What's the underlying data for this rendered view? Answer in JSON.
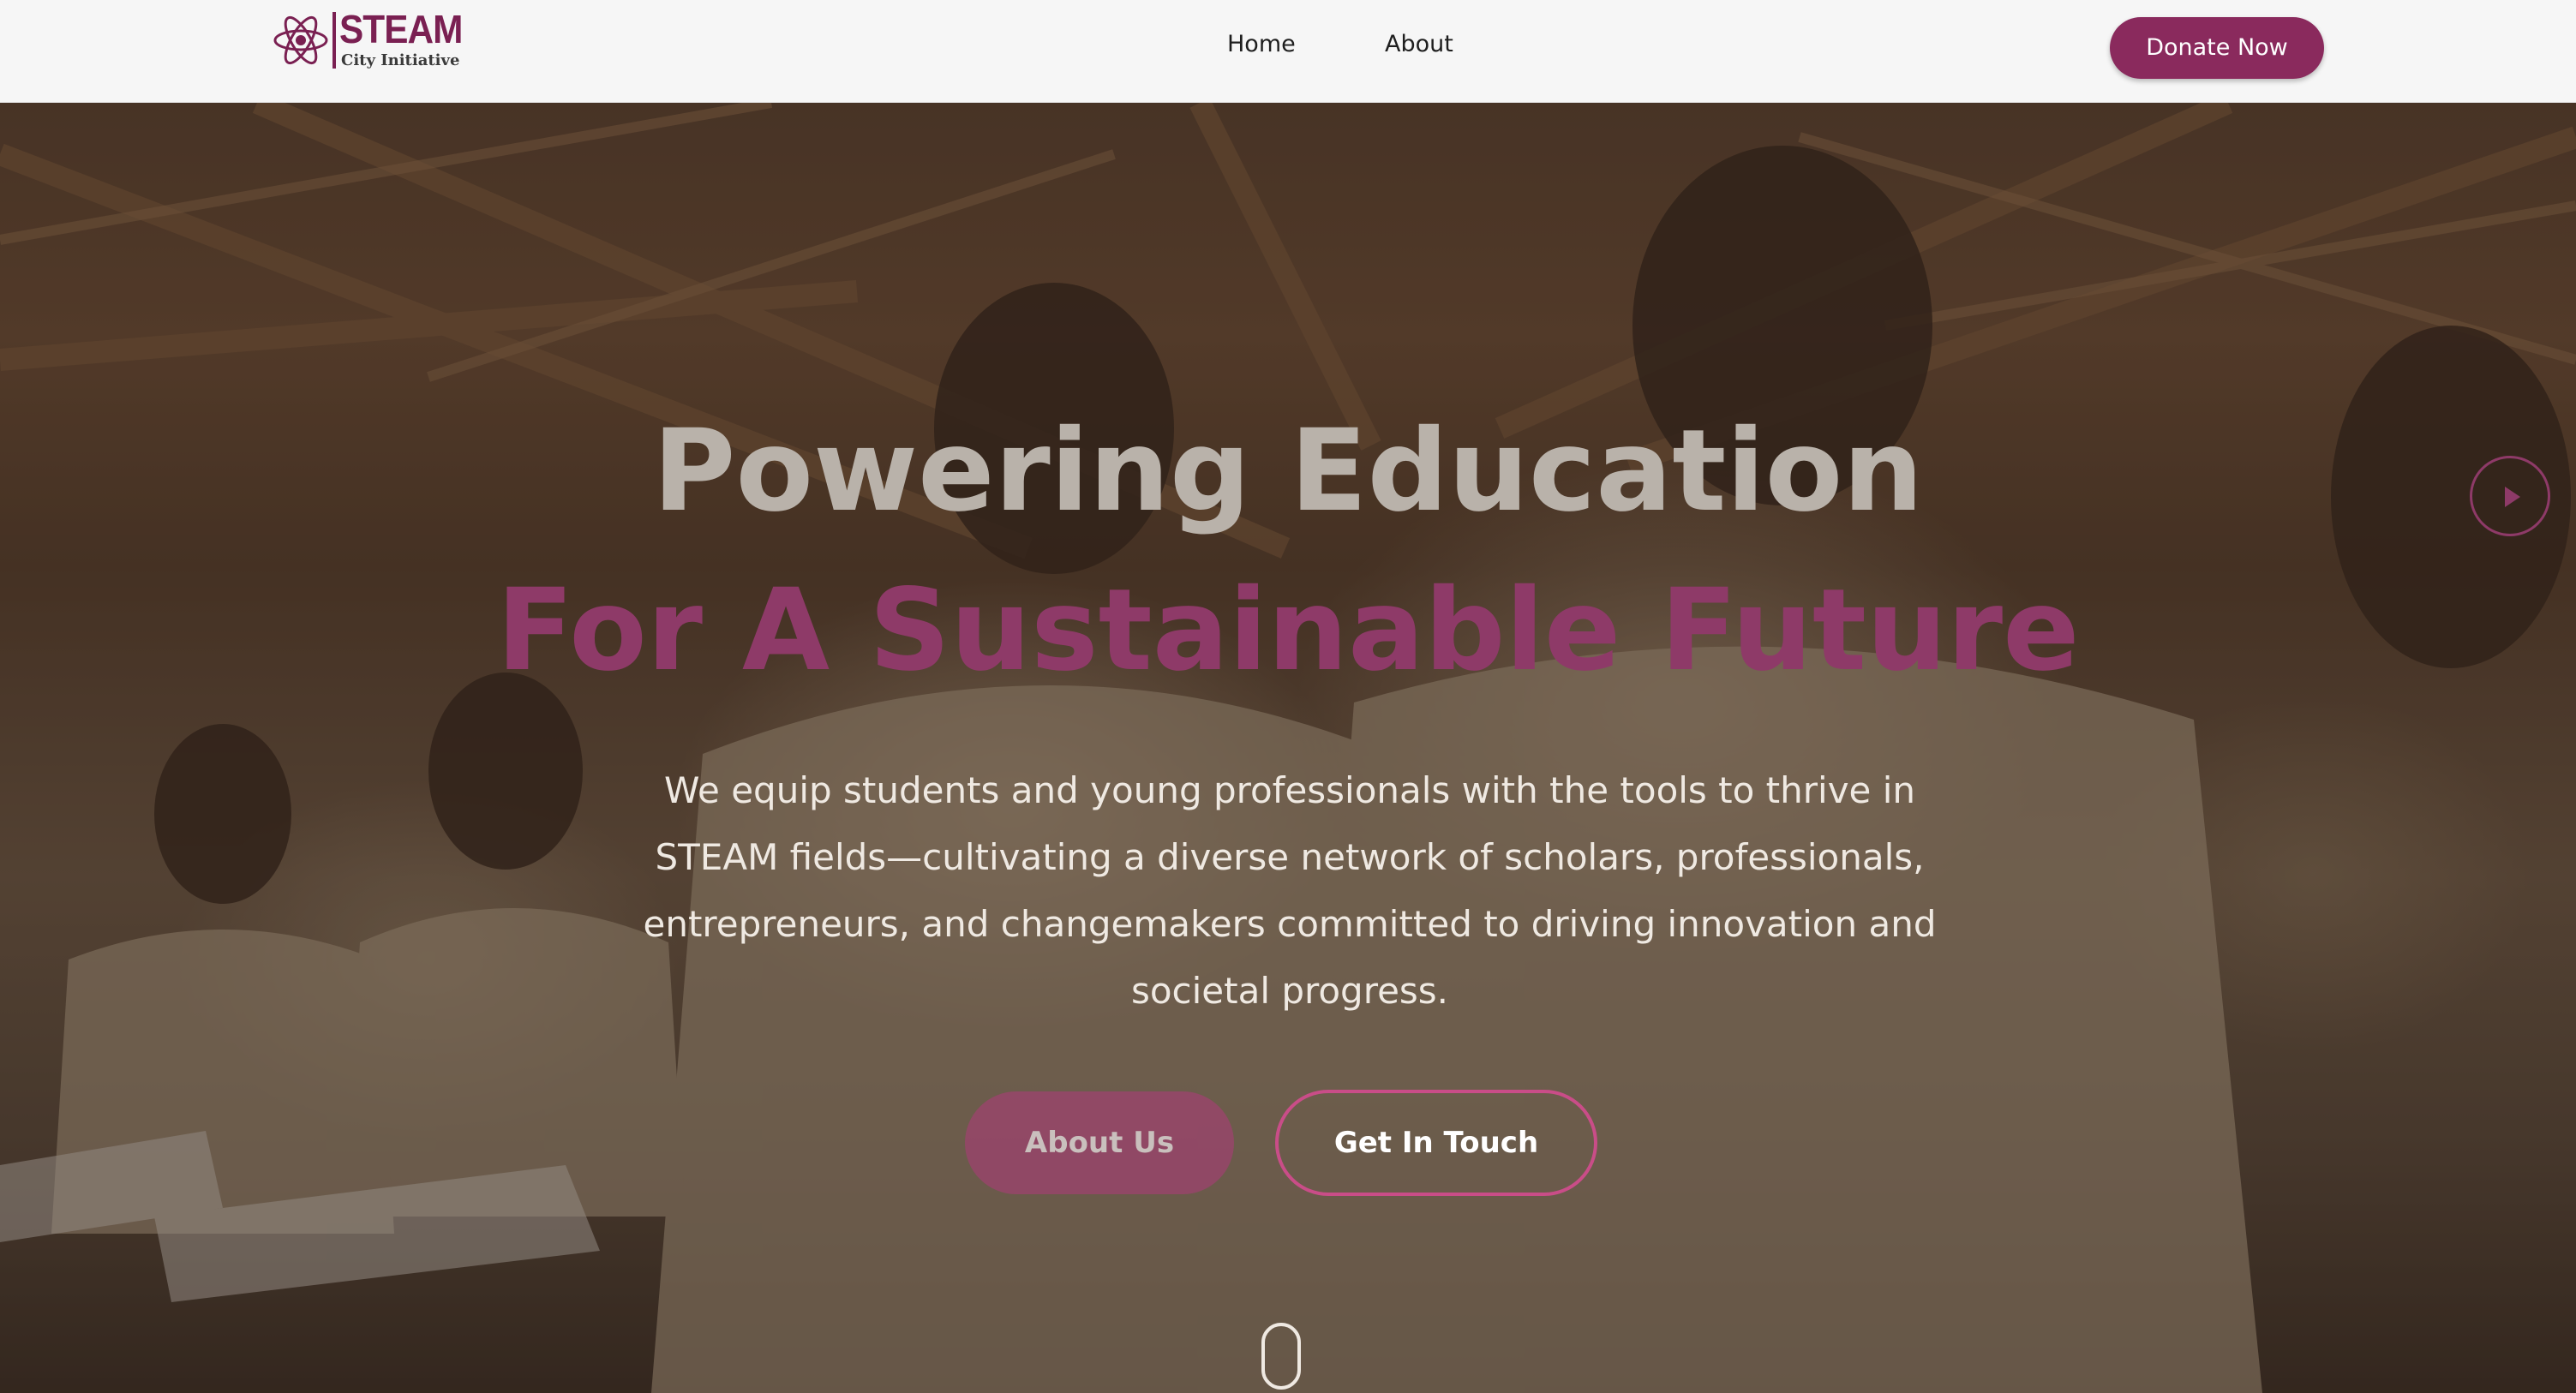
{
  "brand": {
    "title": "STEAM",
    "subtitle": "City Initiative",
    "logo_icon": "atom-flower-icon",
    "accent_color": "#8a2a5d"
  },
  "nav": {
    "items": [
      {
        "label": "Home"
      },
      {
        "label": "About"
      }
    ],
    "donate_label": "Donate Now"
  },
  "hero": {
    "headline_line1": "Powering Education",
    "headline_line2": "For A Sustainable Future",
    "description": "We equip students and young professionals with the tools to thrive in STEAM fields—cultivating a diverse network of scholars, professionals, entrepreneurs, and changemakers committed to driving innovation and societal progress.",
    "primary_button": "About Us",
    "secondary_button": "Get In Touch",
    "play_icon": "play-icon",
    "scroll_icon": "scroll-mouse-icon",
    "background_image": "students-writing-in-classroom-photo"
  }
}
